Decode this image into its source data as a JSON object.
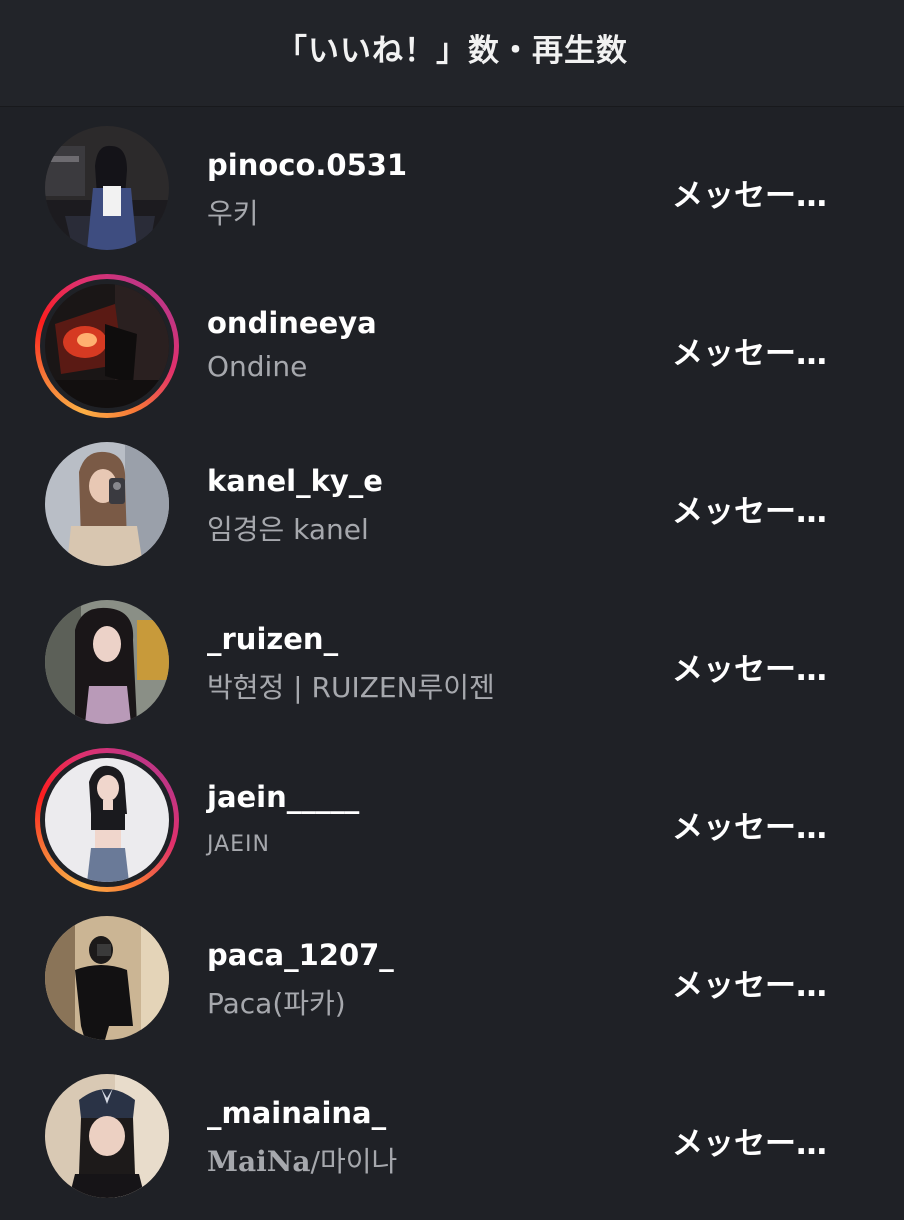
{
  "header": {
    "title": "「いいね！」数・再生数"
  },
  "users": [
    {
      "username": "pinoco.0531",
      "full_name": "우키",
      "action_label": "メッセー…",
      "story_ring": false
    },
    {
      "username": "ondineeya",
      "full_name": "Ondine",
      "action_label": "メッセー…",
      "story_ring": true
    },
    {
      "username": "kanel_ky_e",
      "full_name": "임경은 kanel",
      "action_label": "メッセー…",
      "story_ring": false
    },
    {
      "username": "_ruizen_",
      "full_name": "박현정 | RUIZEN루이젠",
      "action_label": "メッセー…",
      "story_ring": false
    },
    {
      "username": "jaein_____",
      "full_name": "JAEIN",
      "action_label": "メッセー…",
      "story_ring": true
    },
    {
      "username": "paca_1207_",
      "full_name": "Paca(파카)",
      "action_label": "メッセー…",
      "story_ring": false
    },
    {
      "username": "_mainaina_",
      "full_name_serif": "MaiNa",
      "full_name_rest": "/마이나",
      "action_label": "メッセー…",
      "story_ring": false
    }
  ],
  "colors": {
    "background": "#1f2126",
    "username": "#ffffff",
    "full_name": "#a6a8ad",
    "story_ring_start": "#fcaf45",
    "story_ring_end": "#c13584"
  }
}
